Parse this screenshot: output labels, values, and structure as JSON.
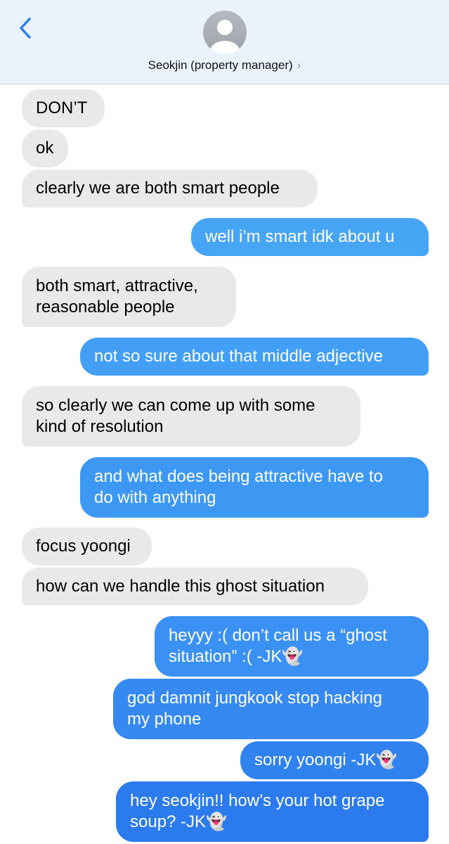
{
  "header": {
    "contact_name": "Seokjin (property manager)",
    "chevron": "›",
    "avatar_icon": "person-silhouette-icon",
    "back_icon": "chevron-left-icon",
    "accent_color": "#2a7ef5"
  },
  "messages": [
    {
      "from": "them",
      "lines": [
        "DON’T"
      ]
    },
    {
      "from": "them",
      "lines": [
        "ok"
      ]
    },
    {
      "from": "them",
      "lines": [
        "clearly we are both smart people"
      ]
    },
    {
      "from": "me",
      "lines": [
        "well i’m smart idk about u"
      ]
    },
    {
      "from": "them",
      "lines": [
        "both smart, attractive,",
        "reasonable people"
      ]
    },
    {
      "from": "me",
      "lines": [
        "not so sure about that middle adjective"
      ]
    },
    {
      "from": "them",
      "lines": [
        "so clearly we can come up with some",
        "kind of resolution"
      ]
    },
    {
      "from": "me",
      "lines": [
        "and what does being attractive have to",
        "do with anything"
      ]
    },
    {
      "from": "them",
      "lines": [
        "focus yoongi"
      ]
    },
    {
      "from": "them",
      "lines": [
        "how can we handle this ghost situation"
      ]
    },
    {
      "from": "me",
      "lines": [
        "heyyy :( don’t call us a “ghost",
        "situation” :( -JK👻"
      ]
    },
    {
      "from": "me",
      "lines": [
        "god damnit jungkook stop hacking",
        "my phone"
      ]
    },
    {
      "from": "me",
      "lines": [
        "sorry yoongi -JK👻"
      ]
    },
    {
      "from": "me",
      "lines": [
        "hey seokjin!! how’s your hot grape",
        "soup? -JK👻"
      ]
    }
  ]
}
